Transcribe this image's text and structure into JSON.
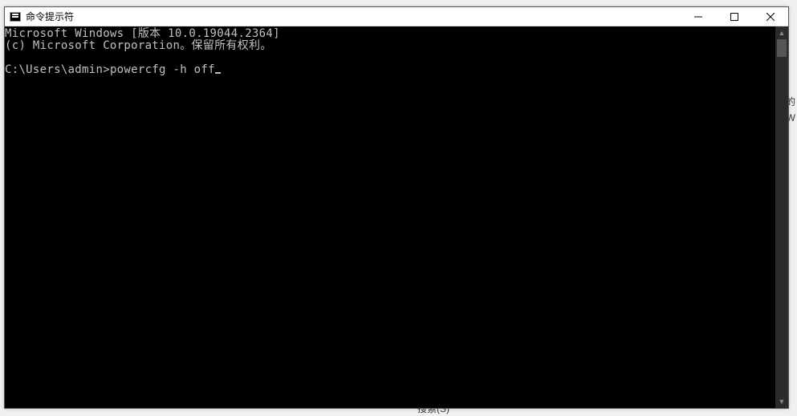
{
  "titlebar": {
    "title": "命令提示符"
  },
  "console": {
    "line1": "Microsoft Windows [版本 10.0.19044.2364]",
    "line2": "(c) Microsoft Corporation。保留所有权利。",
    "prompt": "C:\\Users\\admin>",
    "command": "powercfg -h off"
  },
  "background": {
    "right1": "的",
    "right2": "W",
    "bottom": "搜索(S)"
  }
}
